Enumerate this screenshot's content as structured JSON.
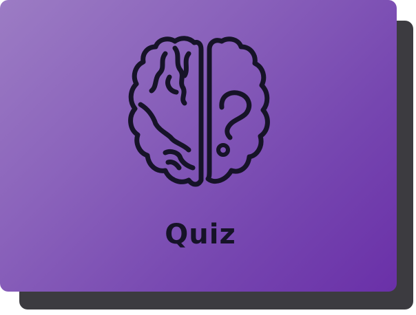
{
  "card": {
    "title": "Quiz",
    "icon": "brain-question-icon"
  },
  "colors": {
    "gradient_start": "#9c7cc4",
    "gradient_end": "#6a30a8",
    "shadow": "#3c3b40",
    "ink": "#161328"
  }
}
